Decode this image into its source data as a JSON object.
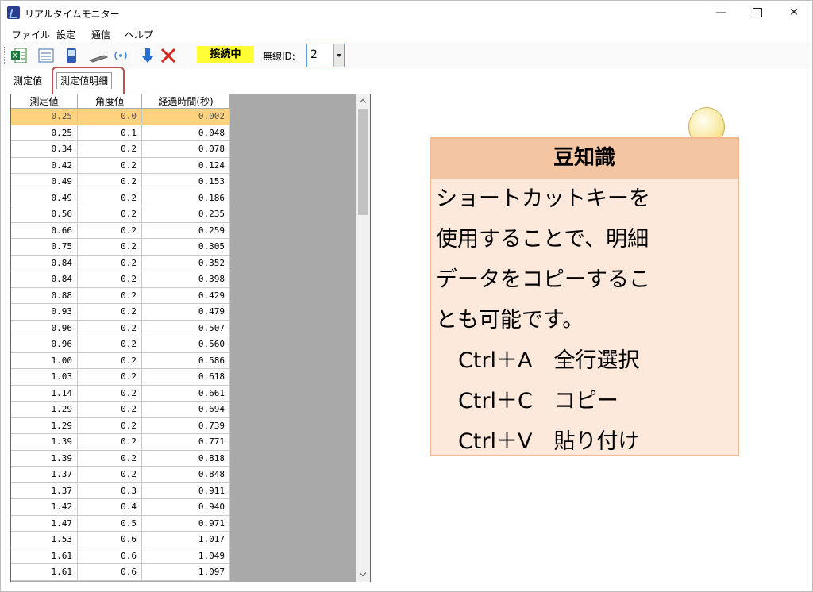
{
  "window": {
    "title": "リアルタイムモニター"
  },
  "menu": [
    "ファイル",
    "設定",
    "通信",
    "ヘルプ"
  ],
  "toolbar": {
    "icons": [
      "excel-icon",
      "list-icon",
      "device-icon",
      "probe-icon",
      "signal-icon",
      "download-icon",
      "delete-icon"
    ],
    "status": "接続中",
    "radio_label": "無線ID:",
    "radio_value": "2"
  },
  "tabs": [
    "測定値",
    "測定値明細"
  ],
  "grid": {
    "columns": [
      "測定値",
      "角度値",
      "経過時間(秒)"
    ],
    "rows": [
      [
        "0.25",
        "0.0",
        "0.002"
      ],
      [
        "0.25",
        "0.1",
        "0.048"
      ],
      [
        "0.34",
        "0.2",
        "0.078"
      ],
      [
        "0.42",
        "0.2",
        "0.124"
      ],
      [
        "0.49",
        "0.2",
        "0.153"
      ],
      [
        "0.49",
        "0.2",
        "0.186"
      ],
      [
        "0.56",
        "0.2",
        "0.235"
      ],
      [
        "0.66",
        "0.2",
        "0.259"
      ],
      [
        "0.75",
        "0.2",
        "0.305"
      ],
      [
        "0.84",
        "0.2",
        "0.352"
      ],
      [
        "0.84",
        "0.2",
        "0.398"
      ],
      [
        "0.88",
        "0.2",
        "0.429"
      ],
      [
        "0.93",
        "0.2",
        "0.479"
      ],
      [
        "0.96",
        "0.2",
        "0.507"
      ],
      [
        "0.96",
        "0.2",
        "0.560"
      ],
      [
        "1.00",
        "0.2",
        "0.586"
      ],
      [
        "1.03",
        "0.2",
        "0.618"
      ],
      [
        "1.14",
        "0.2",
        "0.661"
      ],
      [
        "1.29",
        "0.2",
        "0.694"
      ],
      [
        "1.29",
        "0.2",
        "0.739"
      ],
      [
        "1.39",
        "0.2",
        "0.771"
      ],
      [
        "1.39",
        "0.2",
        "0.818"
      ],
      [
        "1.37",
        "0.2",
        "0.848"
      ],
      [
        "1.37",
        "0.3",
        "0.911"
      ],
      [
        "1.42",
        "0.4",
        "0.940"
      ],
      [
        "1.47",
        "0.5",
        "0.971"
      ],
      [
        "1.53",
        "0.6",
        "1.017"
      ],
      [
        "1.61",
        "0.6",
        "1.049"
      ],
      [
        "1.61",
        "0.6",
        "1.097"
      ]
    ]
  },
  "tip": {
    "title": "豆知識",
    "lines": [
      "ショートカットキーを",
      "使用することで、明細",
      "データをコピーするこ",
      "とも可能です。"
    ],
    "shortcuts": [
      {
        "key": "Ctrl＋A",
        "action": "全行選択"
      },
      {
        "key": "Ctrl＋C",
        "action": "コピー"
      },
      {
        "key": "Ctrl＋V",
        "action": "貼り付け"
      }
    ]
  }
}
